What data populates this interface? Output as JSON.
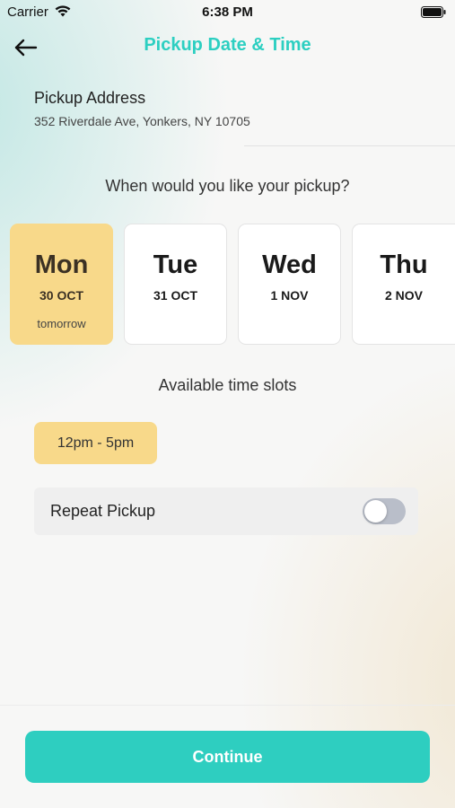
{
  "status_bar": {
    "carrier": "Carrier",
    "time": "6:38 PM"
  },
  "header": {
    "title": "Pickup Date & Time",
    "back_icon": "arrow-left-icon"
  },
  "address": {
    "label": "Pickup Address",
    "value": "352 Riverdale Ave, Yonkers, NY 10705"
  },
  "question": "When would you like your pickup?",
  "days": [
    {
      "name": "Mon",
      "date": "30 OCT",
      "sub": "tomorrow",
      "selected": true
    },
    {
      "name": "Tue",
      "date": "31 OCT",
      "sub": "",
      "selected": false
    },
    {
      "name": "Wed",
      "date": "1 NOV",
      "sub": "",
      "selected": false
    },
    {
      "name": "Thu",
      "date": "2 NOV",
      "sub": "",
      "selected": false
    }
  ],
  "slots": {
    "title": "Available time slots",
    "items": [
      "12pm - 5pm"
    ]
  },
  "repeat": {
    "label": "Repeat Pickup",
    "enabled": false
  },
  "continue_label": "Continue",
  "colors": {
    "accent": "#2ecec0",
    "selected": "#f8d98a",
    "toggle_off": "#b9bec9"
  }
}
